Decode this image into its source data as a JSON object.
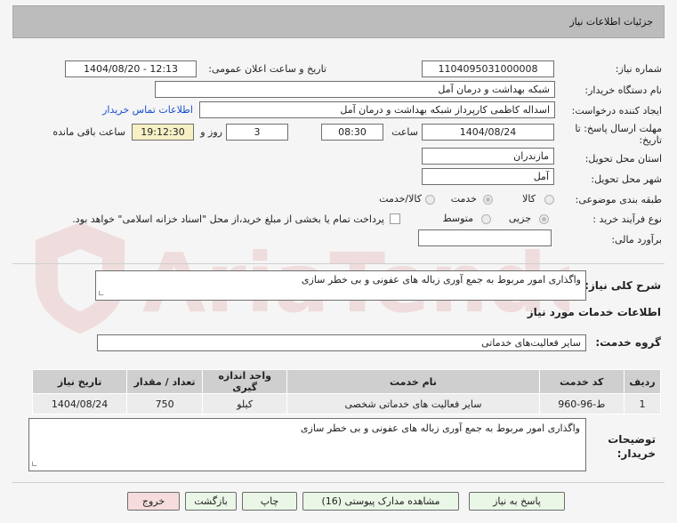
{
  "header": {
    "title": "جزئیات اطلاعات نیاز"
  },
  "form": {
    "need_number_label": "شماره نیاز:",
    "need_number": "1104095031000008",
    "announce_label": "تاریخ و ساعت اعلان عمومی:",
    "announce_value": "1404/08/20 - 12:13",
    "buyer_org_label": "نام دستگاه خریدار:",
    "buyer_org": "شبکه بهداشت و درمان آمل",
    "creator_label": "ایجاد کننده درخواست:",
    "creator": "اسداله کاظمی کارپرداز شبکه بهداشت و درمان آمل",
    "contact_link": "اطلاعات تماس خریدار",
    "deadline_label_1": "مهلت ارسال پاسخ: تا",
    "deadline_label_2": "تاریخ:",
    "deadline_date": "1404/08/24",
    "time_label": "ساعت",
    "deadline_time": "08:30",
    "days_value": "3",
    "days_label": "روز و",
    "remaining_time": "19:12:30",
    "remaining_label": "ساعت باقی مانده",
    "province_label": "استان محل تحویل:",
    "province": "مازندران",
    "city_label": "شهر محل تحویل:",
    "city": "آمل",
    "category_label": "طبقه بندی موضوعی:",
    "category_options": [
      "کالا",
      "خدمت",
      "کالا/خدمت"
    ],
    "category_selected": "خدمت",
    "purchase_type_label": "نوع فرآیند خرید :",
    "purchase_options": [
      "جزیی",
      "متوسط"
    ],
    "purchase_selected": "جزیی",
    "payment_note": "پرداخت تمام یا بخشی از مبلغ خرید،از محل \"اسناد خزانه اسلامی\" خواهد بود.",
    "estimate_label": "برآورد مالی:",
    "estimate_value": ""
  },
  "summary": {
    "label": "شرح کلی نیاز:",
    "value": "واگذاری امور مربوط به جمع آوری زباله های عفونی و بی خطر سازی"
  },
  "services": {
    "section_title": "اطلاعات خدمات مورد نیاز",
    "group_label": "گروه خدمت:",
    "group_value": "سایر فعالیت‌های خدماتی"
  },
  "table": {
    "headers": [
      "ردیف",
      "کد خدمت",
      "نام خدمت",
      "واحد اندازه گیری",
      "تعداد / مقدار",
      "تاریخ نیاز"
    ],
    "rows": [
      [
        "1",
        "ط-96-960",
        "سایر فعالیت های خدماتی شخصی",
        "کیلو",
        "750",
        "1404/08/24"
      ]
    ]
  },
  "notes": {
    "label_1": "توضیحات",
    "label_2": "خریدار:",
    "value": "واگذاری امور مربوط به جمع آوری زباله های عفونی و بی خطر سازی"
  },
  "buttons": {
    "reply": "پاسخ به نیاز",
    "attachments": "مشاهده مدارک پیوستی (16)",
    "print": "چاپ",
    "back": "بازگشت",
    "exit": "خروج"
  },
  "watermark": {
    "text": "AriaTender.neT"
  },
  "colors": {
    "header_bg": "#bcbcbc",
    "table_header_bg": "#cfcfcf",
    "button_bg": "#eaf6e6",
    "exit_button_bg": "#f6dcdc",
    "remaining_bg": "#f7f0c6",
    "link": "#1a4fd1"
  }
}
